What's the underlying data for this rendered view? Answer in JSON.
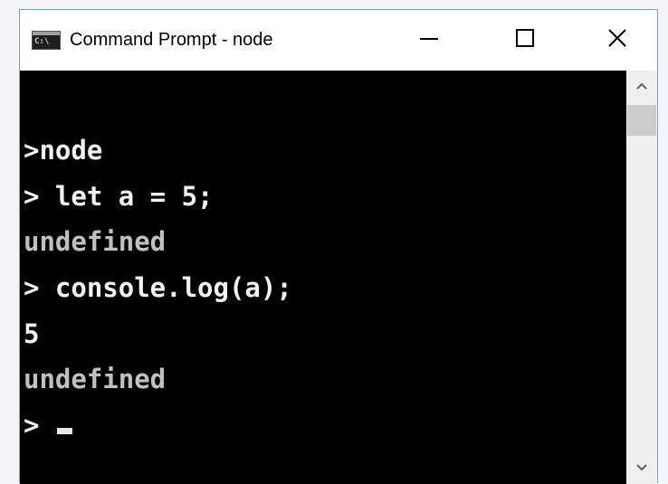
{
  "window": {
    "title": "Command Prompt - node",
    "icon": "cmd-app-icon",
    "icon_text": "C:\\"
  },
  "controls": {
    "minimize_icon": "minimize-icon",
    "maximize_icon": "maximize-icon",
    "close_icon": "close-icon"
  },
  "console": {
    "lines": [
      {
        "text": ">node",
        "style": "bright"
      },
      {
        "text": "> let a = 5;",
        "style": "bright"
      },
      {
        "text": "undefined",
        "style": "gray"
      },
      {
        "text": "> console.log(a);",
        "style": "bright"
      },
      {
        "text": "5",
        "style": "bright"
      },
      {
        "text": "undefined",
        "style": "gray"
      },
      {
        "text": "> ",
        "style": "bright"
      }
    ],
    "background": "#000000",
    "foreground": "#f2f2f2",
    "dim_foreground": "#c0c0c0"
  },
  "scrollbar": {
    "up_icon": "chevron-up-icon",
    "down_icon": "chevron-down-icon"
  }
}
